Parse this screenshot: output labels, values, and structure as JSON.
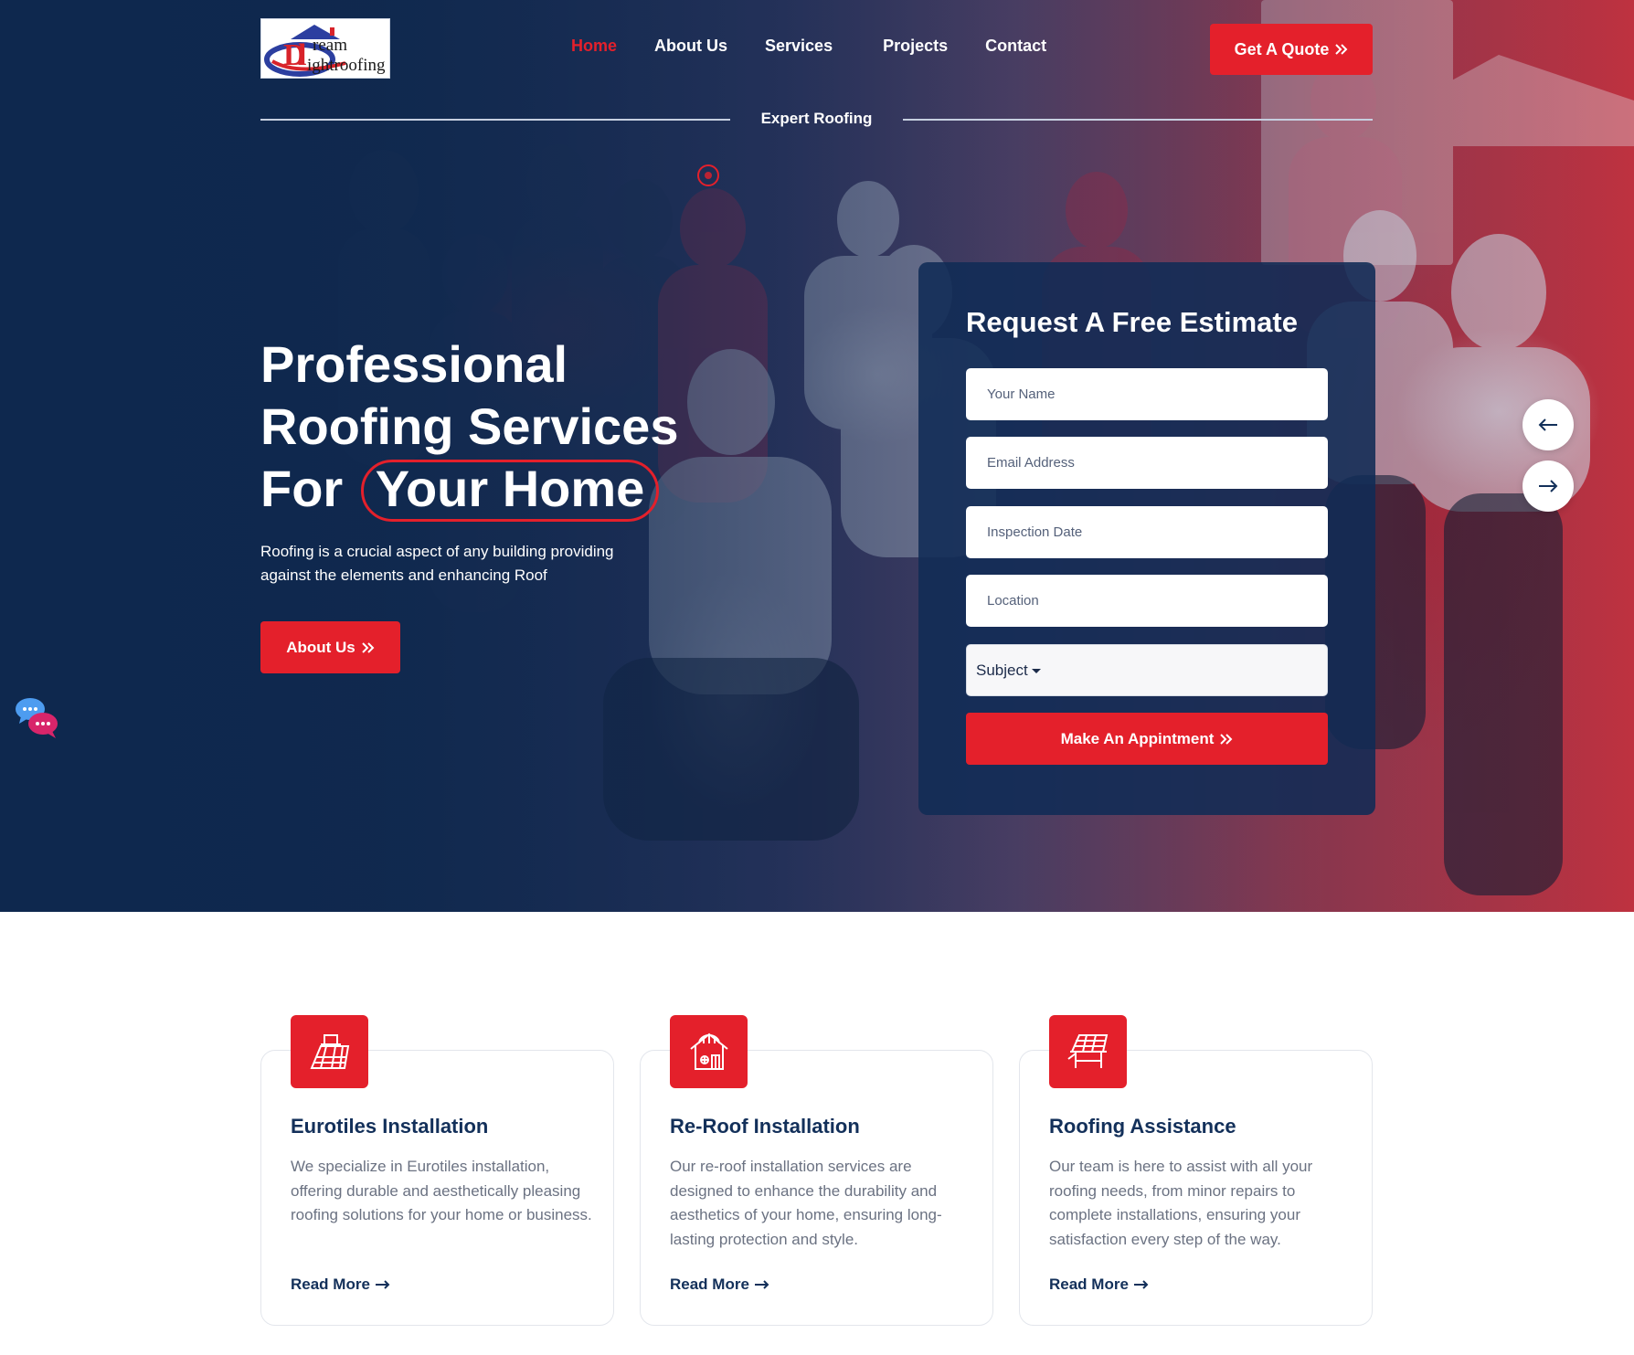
{
  "header": {
    "logo_alt": "Dream Lightroofing",
    "nav": [
      {
        "label": "Home"
      },
      {
        "label": "About Us"
      },
      {
        "label": "Services"
      },
      {
        "label": "Projects"
      },
      {
        "label": "Contact"
      }
    ],
    "quote_button": "Get A Quote"
  },
  "hero": {
    "tagline": "Expert Roofing",
    "title_line1": "Professional",
    "title_line2": "Roofing Services",
    "title_line3_prefix": "For",
    "title_highlight": "Your Home",
    "description": "Roofing is a crucial aspect of any building providing against the elements and enhancing Roof",
    "about_button": "About Us"
  },
  "estimate_form": {
    "title": "Request A Free Estimate",
    "name_placeholder": "Your Name",
    "email_placeholder": "Email Address",
    "date_placeholder": "Inspection Date",
    "location_placeholder": "Location",
    "subject_label": "Subject",
    "submit_label": "Make An Appintment"
  },
  "services": [
    {
      "title": "Eurotiles Installation",
      "text": "We specialize in Eurotiles installation, offering durable and aesthetically pleasing roofing solutions for your home or business.",
      "link": "Read More",
      "icon": "roof-tiles-icon"
    },
    {
      "title": "Re-Roof Installation",
      "text": "Our re-roof installation services are designed to enhance the durability and aesthetics of your home, ensuring long-lasting protection and style.",
      "link": "Read More",
      "icon": "house-roof-icon"
    },
    {
      "title": "Roofing Assistance",
      "text": "Our team is here to assist with all your roofing needs, from minor repairs to complete installations, ensuring your satisfaction every step of the way.",
      "link": "Read More",
      "icon": "roof-repair-icon"
    }
  ],
  "colors": {
    "accent": "#e4202b",
    "navy": "#13305a",
    "hero_overlay": "#0f2c52"
  }
}
